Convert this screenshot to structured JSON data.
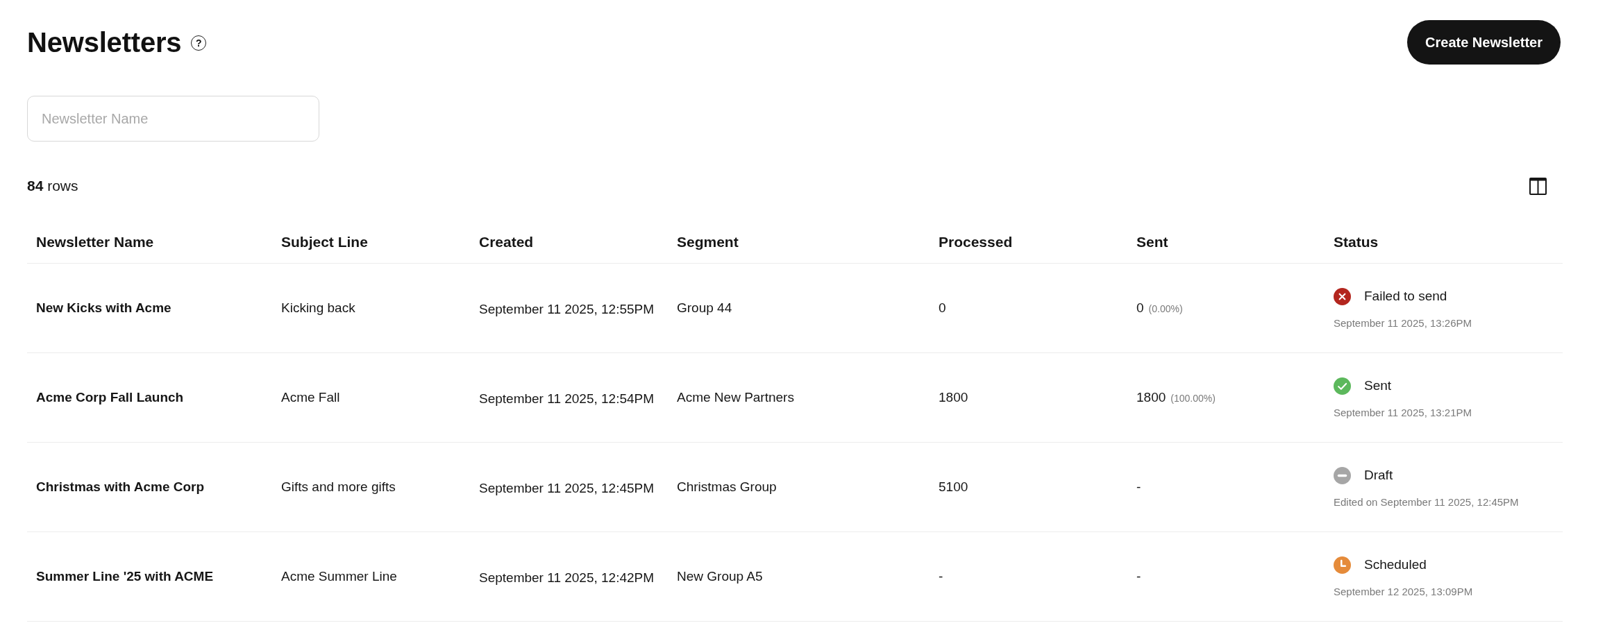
{
  "header": {
    "title": "Newsletters",
    "help": "?",
    "create_button": "Create Newsletter"
  },
  "search": {
    "placeholder": "Newsletter Name"
  },
  "row_count": "**84** rows",
  "table": {
    "columns": [
      "Newsletter Name",
      "Subject Line",
      "Created",
      "Segment",
      "Processed",
      "Sent",
      "Status"
    ],
    "rows": [
      {
        "name": "New Kicks with Acme",
        "subject": "Kicking back",
        "created": "September 11 2025, 12:55PM",
        "segment": "Group 44",
        "processed": "0",
        "sent": {
          "count": "0",
          "percent": "(0.00%)"
        },
        "status": {
          "kind": "failed",
          "color": "#b3261e",
          "label": "Failed to send",
          "detail": "September 11 2025, 13:26PM"
        }
      },
      {
        "name": "Acme Corp Fall Launch",
        "subject": "Acme Fall",
        "created": "September 11 2025, 12:54PM",
        "segment": "Acme New Partners",
        "processed": "1800",
        "sent": {
          "count": "1800",
          "percent": "(100.00%)"
        },
        "status": {
          "kind": "sent",
          "color": "#5cb85c",
          "label": "Sent",
          "detail": "September 11 2025, 13:21PM"
        }
      },
      {
        "name": "Christmas with Acme Corp",
        "subject": "Gifts and more gifts",
        "created": "September 11 2025, 12:45PM",
        "segment": "Christmas Group",
        "processed": "5100",
        "sent": {
          "count": "-"
        },
        "status": {
          "kind": "draft",
          "color": "#a6a6a6",
          "label": "Draft",
          "detail": "Edited on September 11 2025, 12:45PM"
        }
      },
      {
        "name": "Summer Line '25 with ACME",
        "subject": "Acme Summer Line",
        "created": "September 11 2025, 12:42PM",
        "segment": "New Group A5",
        "processed": "-",
        "sent": {
          "count": "-"
        },
        "status": {
          "kind": "scheduled",
          "color": "#e58b3a",
          "label": "Scheduled",
          "detail": "September 12 2025, 13:09PM"
        }
      }
    ]
  }
}
